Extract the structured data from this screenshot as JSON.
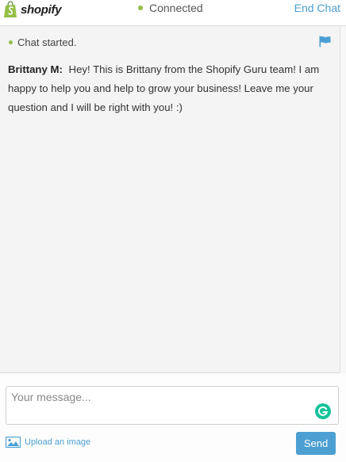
{
  "header": {
    "logo_text": "shopify",
    "status_text": "Connected",
    "end_chat_label": "End Chat"
  },
  "chat": {
    "started_text": "Chat started.",
    "messages": [
      {
        "sender": "Brittany M:",
        "text": "Hey! This is Brittany from the Shopify Guru team! I am happy to help you and help to grow your business! Leave me your question and I will be right with you! :)"
      }
    ]
  },
  "composer": {
    "placeholder": "Your message...",
    "upload_label": "Upload an image",
    "send_label": "Send"
  },
  "icons": {
    "logo": "shopify-bag-icon",
    "flag": "flag-icon",
    "grammarly": "grammarly-icon",
    "upload": "image-icon"
  },
  "colors": {
    "accent": "#4c9fd3",
    "status_dot": "#95bf47",
    "grammarly": "#15c39a",
    "chat_bg": "#f4f4f4"
  }
}
